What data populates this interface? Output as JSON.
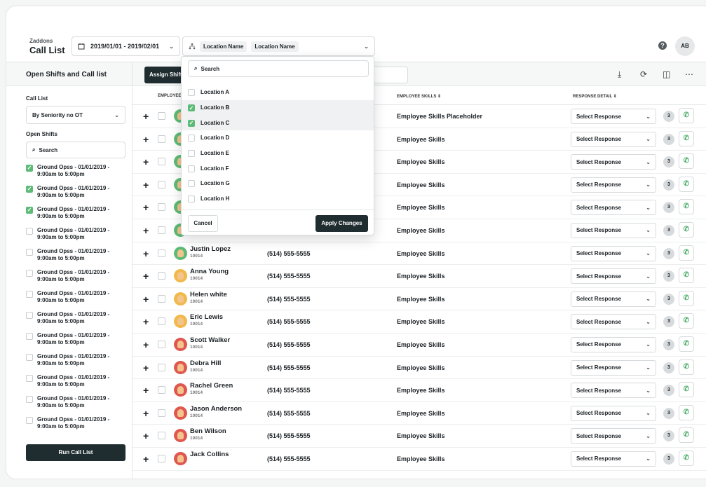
{
  "header": {
    "brand_sub": "Zaddons",
    "title": "Call List",
    "date_range": "2019/01/01 - 2019/02/01",
    "location_chip_1": "Location Name",
    "location_chip_2": "Location Name",
    "user_initials": "AB",
    "help_label": "?"
  },
  "sidebar": {
    "title": "Open Shifts and Call list",
    "call_list_label": "Call List",
    "call_list_value": "By Seniority no OT",
    "open_shifts_label": "Open Shifts",
    "search_placeholder": "Search",
    "shifts": [
      {
        "line1": "Ground Opss - 01/01/2019 -",
        "line2": "9:00am to 5:00pm",
        "checked": true
      },
      {
        "line1": "Ground Opss - 01/01/2019 -",
        "line2": "9:00am to 5:00pm",
        "checked": true
      },
      {
        "line1": "Ground Opss - 01/01/2019 -",
        "line2": "9:00am to 5:00pm",
        "checked": true
      },
      {
        "line1": "Ground Opss - 01/01/2019 -",
        "line2": "9:00am to 5:00pm",
        "checked": false
      },
      {
        "line1": "Ground Opss - 01/01/2019 -",
        "line2": "9:00am to 5:00pm",
        "checked": false
      },
      {
        "line1": "Ground Opss - 01/01/2019 -",
        "line2": "9:00am to 5:00pm",
        "checked": false
      },
      {
        "line1": "Ground Opss - 01/01/2019 -",
        "line2": "9:00am to 5:00pm",
        "checked": false
      },
      {
        "line1": "Ground Opss - 01/01/2019 -",
        "line2": "9:00am to 5:00pm",
        "checked": false
      },
      {
        "line1": "Ground Opss - 01/01/2019 -",
        "line2": "9:00am to 5:00pm",
        "checked": false
      },
      {
        "line1": "Ground Opss - 01/01/2019 -",
        "line2": "9:00am to 5:00pm",
        "checked": false
      },
      {
        "line1": "Ground Opss - 01/01/2019 -",
        "line2": "9:00am to 5:00pm",
        "checked": false
      },
      {
        "line1": "Ground Opss - 01/01/2019 -",
        "line2": "9:00am to 5:00pm",
        "checked": false
      },
      {
        "line1": "Ground Opss - 01/01/2019 -",
        "line2": "9:00am to 5:00pm",
        "checked": false
      }
    ],
    "run_button": "Run Call List"
  },
  "toolbar": {
    "assign_button": "Assign Shift"
  },
  "table": {
    "columns": {
      "employee": "EMPLOYEE",
      "skills": "EMPLOYEE SKILLS ⇕",
      "response": "RESPONSE DETAIL ⇕"
    },
    "response_placeholder": "Select Response",
    "rows": [
      {
        "name": "",
        "id": "",
        "phone": "",
        "skills": "Employee Skills Placeholder",
        "count": "3",
        "avatar": "#5dbb77"
      },
      {
        "name": "",
        "id": "",
        "phone": "",
        "skills": "Employee Skills",
        "count": "3",
        "avatar": "#5dbb77"
      },
      {
        "name": "",
        "id": "",
        "phone": "",
        "skills": "Employee Skills",
        "count": "3",
        "avatar": "#5dbb77"
      },
      {
        "name": "",
        "id": "",
        "phone": "",
        "skills": "Employee Skills",
        "count": "3",
        "avatar": "#5dbb77"
      },
      {
        "name": "",
        "id": "",
        "phone": "",
        "skills": "Employee Skills",
        "count": "3",
        "avatar": "#5dbb77"
      },
      {
        "name": "",
        "id": "",
        "phone": "",
        "skills": "Employee Skills",
        "count": "3",
        "avatar": "#5dbb77"
      },
      {
        "name": "Justin Lopez",
        "id": "10014",
        "phone": "(514) 555-5555",
        "skills": "Employee Skills",
        "count": "3",
        "avatar": "#5dbb77"
      },
      {
        "name": "Anna Young",
        "id": "10014",
        "phone": "(514) 555-5555",
        "skills": "Employee Skills",
        "count": "3",
        "avatar": "#f0b94a"
      },
      {
        "name": "Helen white",
        "id": "10014",
        "phone": "(514) 555-5555",
        "skills": "Employee Skills",
        "count": "3",
        "avatar": "#f0b94a"
      },
      {
        "name": "Eric Lewis",
        "id": "10014",
        "phone": "(514) 555-5555",
        "skills": "Employee Skills",
        "count": "3",
        "avatar": "#f0b94a"
      },
      {
        "name": "Scott Walker",
        "id": "10014",
        "phone": "(514) 555-5555",
        "skills": "Employee Skills",
        "count": "3",
        "avatar": "#e0574f"
      },
      {
        "name": "Debra Hill",
        "id": "10014",
        "phone": "(514) 555-5555",
        "skills": "Employee Skills",
        "count": "3",
        "avatar": "#e0574f"
      },
      {
        "name": "Rachel Green",
        "id": "10014",
        "phone": "(514) 555-5555",
        "skills": "Employee Skills",
        "count": "3",
        "avatar": "#e0574f"
      },
      {
        "name": "Jason Anderson",
        "id": "10014",
        "phone": "(514) 555-5555",
        "skills": "Employee Skills",
        "count": "3",
        "avatar": "#e0574f"
      },
      {
        "name": "Ben Wilson",
        "id": "10014",
        "phone": "(514) 555-5555",
        "skills": "Employee Skills",
        "count": "3",
        "avatar": "#e0574f"
      },
      {
        "name": "Jack Collins",
        "id": "",
        "phone": "(514) 555-5555",
        "skills": "Employee Skills",
        "count": "3",
        "avatar": "#e0574f"
      }
    ]
  },
  "location_dropdown": {
    "search_placeholder": "Search",
    "items": [
      {
        "label": "Location A",
        "checked": false
      },
      {
        "label": "Location B",
        "checked": true
      },
      {
        "label": "Location C",
        "checked": true
      },
      {
        "label": "Location D",
        "checked": false
      },
      {
        "label": "Location E",
        "checked": false
      },
      {
        "label": "Location F",
        "checked": false
      },
      {
        "label": "Location G",
        "checked": false
      },
      {
        "label": "Location H",
        "checked": false
      }
    ],
    "cancel": "Cancel",
    "apply": "Apply Changes"
  },
  "colors": {
    "accent_green": "#5dbb77",
    "dark_button": "#1f2d30"
  }
}
